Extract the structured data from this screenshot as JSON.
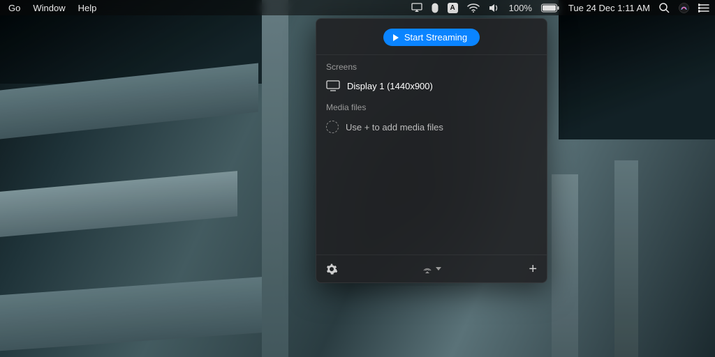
{
  "menubar": {
    "left": {
      "go": "Go",
      "window": "Window",
      "help": "Help"
    },
    "right": {
      "battery_pct": "100%",
      "datetime": "Tue 24 Dec  1:11 AM",
      "input_indicator": "A"
    }
  },
  "panel": {
    "start_button": "Start Streaming",
    "screens_label": "Screens",
    "display_item": "Display 1 (1440x900)",
    "media_label": "Media files",
    "media_placeholder": "Use + to add media files"
  }
}
